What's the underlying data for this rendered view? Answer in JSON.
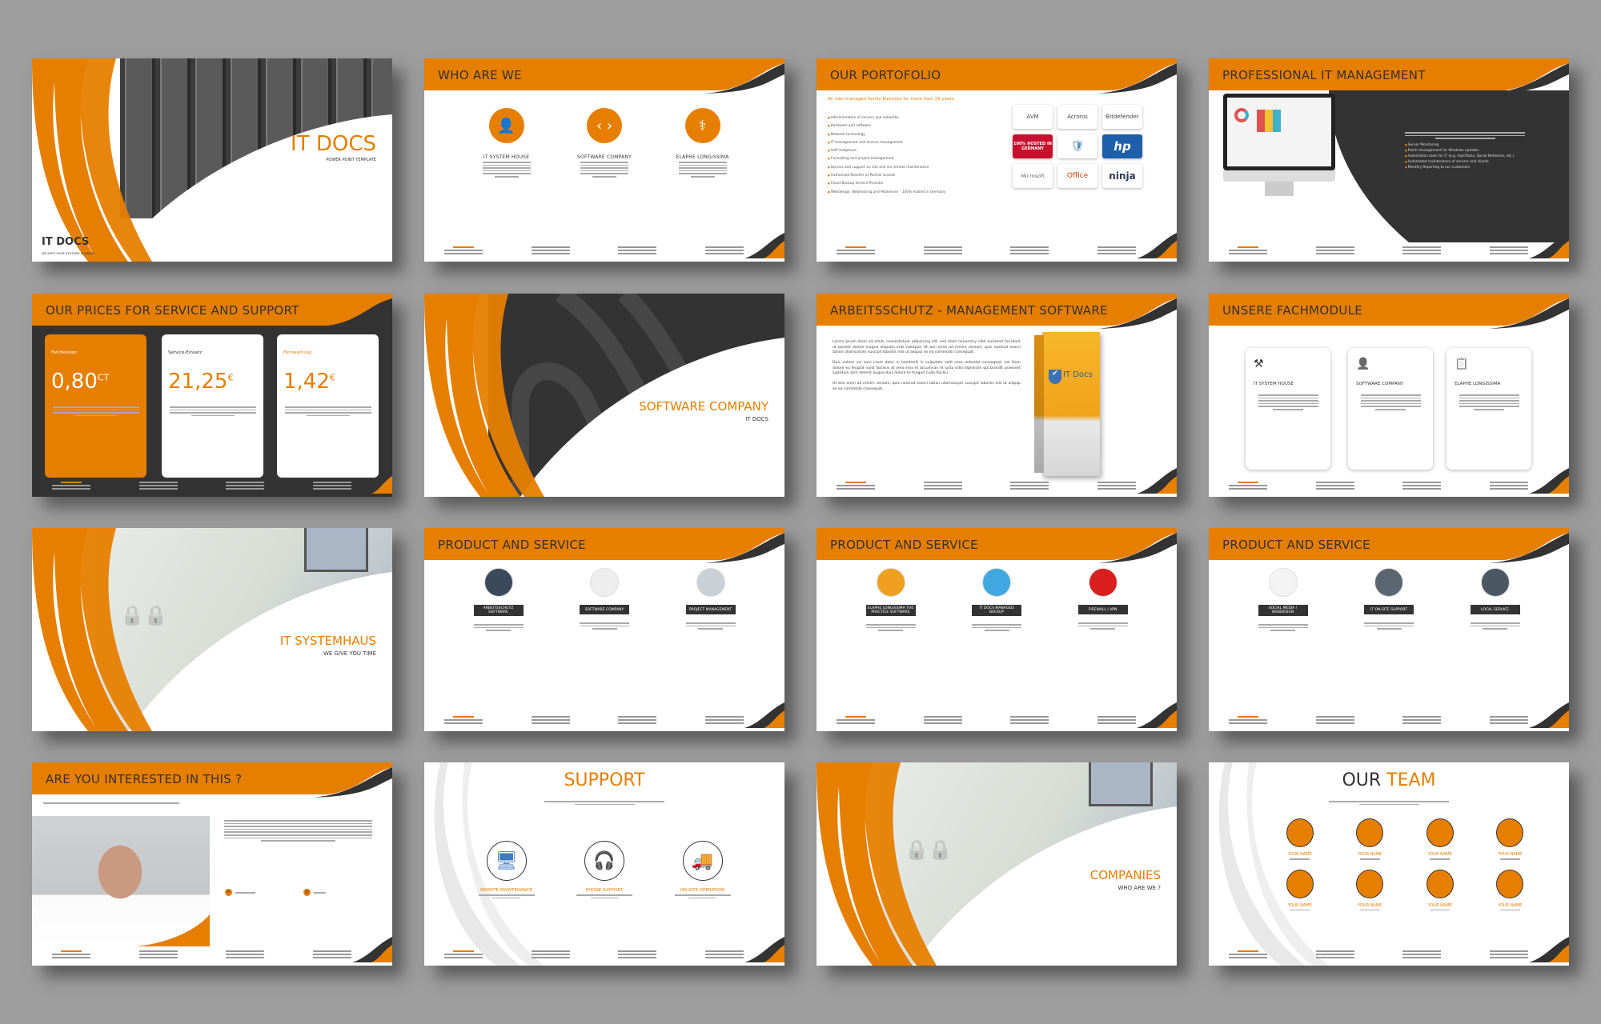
{
  "colors": {
    "accent": "#e67e00",
    "dark": "#333333",
    "background": "#9d9d9d"
  },
  "slides": [
    {
      "type": "cover",
      "title": "IT DOCS",
      "subtitle": "POWER POINT TEMPLATE",
      "logo": "IT DOCS",
      "tagline": "WE KEEP YOUR SYSTEMS RUNNING"
    },
    {
      "type": "three_icons",
      "title": "WHO ARE WE",
      "items": [
        {
          "label": "IT SYSTEM HOUSE",
          "icon": "users-icon"
        },
        {
          "label": "SOFTWARE COMPANY",
          "icon": "code-icon"
        },
        {
          "label": "ELAPHE LONGISSIMA",
          "icon": "caduceus-icon"
        }
      ]
    },
    {
      "type": "portfolio",
      "title": "OUR PORTOFOLIO",
      "subtitle": "An own managed family business for more than 25 years",
      "items": [
        "Administration of servers and networks",
        "Hardware and software",
        "Network technology",
        "IT management and licence management",
        "VoIP telephone",
        "Consulting and project management",
        "Service and support on site and via remote maintenance",
        "Authorized Reseller of Partner brands",
        "Cloud Backup Service Provider",
        "Webdesign, Webhosting and Mailserver - 100% hosted in Germany"
      ],
      "logos": [
        "AVM",
        "Acronis",
        "Bitdefender",
        "100% HOSTED IN GERMANY",
        "shield",
        "hp",
        "Microsoft",
        "Office",
        "ninja"
      ]
    },
    {
      "type": "monitor",
      "title": "PROFESSIONAL IT MANAGEMENT",
      "bullets": [
        "Server Monitoring",
        "Patch management for Windows updates",
        "Automation tools for IT (e.g. AutoTasks, Social Networks, etc.)",
        "Automated maintenance of servers and clients",
        "Monthly Reporting to our customers"
      ]
    },
    {
      "type": "prices",
      "title": "OUR PRICES FOR SERVICE AND SUPPORT",
      "cards": [
        {
          "label": "Fahrtkosten",
          "value": "0,80",
          "unit": "CT",
          "highlight": true
        },
        {
          "label": "Service-Einsatz",
          "value": "21,25",
          "unit": "€",
          "highlight": false
        },
        {
          "label": "Fernwartung",
          "value": "1,42",
          "unit": "€",
          "highlight": false
        }
      ]
    },
    {
      "type": "section_dark",
      "title": "SOFTWARE COMPANY",
      "subtitle": "IT DOCS"
    },
    {
      "type": "box",
      "title": "ARBEITSSCHUTZ - MANAGEMENT SOFTWARE",
      "paragraphs": [
        "Lorem ipsum dolor sit amet, consectetuer adipiscing elit, sed diam nonummy nibh euismod tincidunt ut laoreet dolore magna aliquam erat volutpat. Ut wisi enim ad minim veniam, quis nostrud exerci tation ullamcorper suscipit lobortis nisl ut aliquip ex ea commodo consequat.",
        "Duis autem vel eum iriure dolor in hendrerit in vulputate velit esse molestie consequat, vel illum dolore eu feugiat nulla facilisis at vero eros et accumsan et iusto odio dignissim qui blandit praesent luptatum zzril delenit augue duis dolore te feugait nulla facilisi.",
        "Ut wisi enim ad minim veniam, quis nostrud exerci tation ullamcorper suscipit lobortis nisl ut aliquip ex ea commodo consequat."
      ],
      "box_label": "IT Docs"
    },
    {
      "type": "cards",
      "title": "UNSERE FACHMODULE",
      "items": [
        {
          "label": "IT SYSTEM HOUSE",
          "icon": "worker-icon"
        },
        {
          "label": "SOFTWARE COMPANY",
          "icon": "person-desk-icon"
        },
        {
          "label": "ELAPHE LONGISSIMA",
          "icon": "clipboard-icon"
        }
      ]
    },
    {
      "type": "section_photo",
      "title": "IT SYSTEMHAUS",
      "subtitle": "WE GIVE YOU TIME"
    },
    {
      "type": "products",
      "title": "PRODUCT AND SERVICE",
      "items": [
        "ARBEITSSCHUTZ SOFTWARE",
        "SOFTWARE COMPANY",
        "PROJECT MANAGEMENT"
      ],
      "photos": [
        "#3a4a5a",
        "#eeeeee",
        "#c9d0d6"
      ]
    },
    {
      "type": "products",
      "title": "PRODUCT AND SERVICE",
      "items": [
        "ELAPHE LONGISSIMA THE PRACTICE SOFTWARE",
        "IT DOCS MANAGED BACKUP",
        "FIREWALL / VPN"
      ],
      "photos": [
        "#f0a020",
        "#3fa8e0",
        "#d81e1e"
      ]
    },
    {
      "type": "products",
      "title": "PRODUCT AND SERVICE",
      "items": [
        "SOCIAL MEDIA / WEBDESIGN",
        "IT ON-SITE SUPPORT",
        "LOCAL SERVICE"
      ],
      "photos": [
        "#f4f4f4",
        "#5a6670",
        "#4a5864"
      ]
    },
    {
      "type": "contact",
      "title": "ARE YOU INTERESTED IN THIS ?"
    },
    {
      "type": "support",
      "title": "SUPPORT",
      "items": [
        {
          "label": "REMOTE MAINTENANCE",
          "icon": "monitor-icon"
        },
        {
          "label": "PHONE SUPPORT",
          "icon": "headset-icon"
        },
        {
          "label": "ON-SITE OPERATION",
          "icon": "truck-icon"
        }
      ]
    },
    {
      "type": "section_photo",
      "title": "COMPANIES",
      "subtitle": "WHO ARE WE ?"
    },
    {
      "type": "team",
      "title_a": "OUR",
      "title_b": "TEAM",
      "members": [
        "YOUR NAME",
        "YOUR NAME",
        "YOUR NAME",
        "YOUR NAME",
        "YOUR NAME",
        "YOUR NAME",
        "YOUR NAME",
        "YOUR NAME"
      ]
    }
  ]
}
